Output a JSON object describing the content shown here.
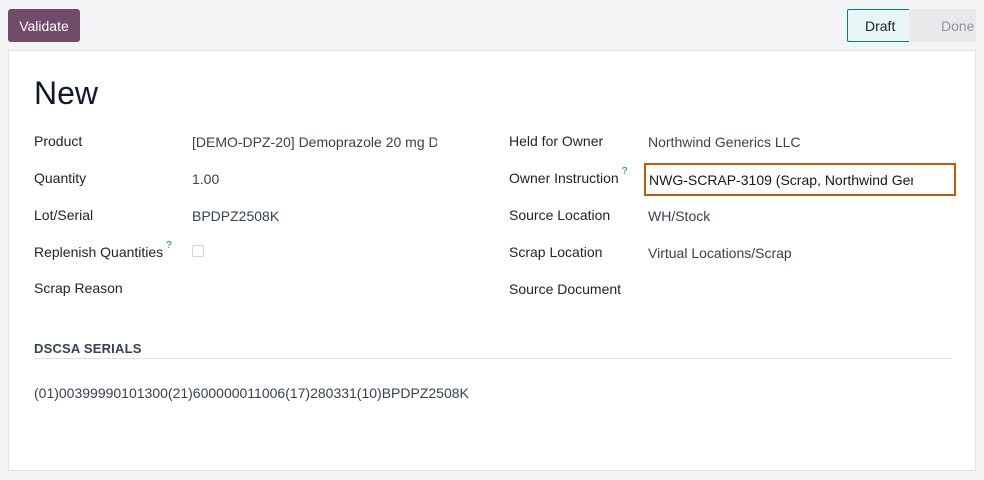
{
  "toolbar": {
    "validate_label": "Validate"
  },
  "statusbar": {
    "stages": [
      "Draft",
      "Done"
    ],
    "active": "Draft"
  },
  "record": {
    "title": "New"
  },
  "left_fields": {
    "product": {
      "label": "Product",
      "value": "[DEMO-DPZ-20] Demoprazole 20 mg D"
    },
    "quantity": {
      "label": "Quantity",
      "value": "1.00"
    },
    "lot_serial": {
      "label": "Lot/Serial",
      "value": "BPDPZ2508K"
    },
    "replenish": {
      "label": "Replenish Quantities",
      "help": "?",
      "checked": false
    },
    "scrap_reason": {
      "label": "Scrap Reason",
      "value": ""
    }
  },
  "right_fields": {
    "owner": {
      "label": "Held for Owner",
      "value": "Northwind Generics LLC"
    },
    "owner_instruction": {
      "label": "Owner Instruction",
      "help": "?",
      "value": "NWG-SCRAP-3109 (Scrap, Northwind Ger"
    },
    "source_location": {
      "label": "Source Location",
      "value": "WH/Stock"
    },
    "scrap_location": {
      "label": "Scrap Location",
      "value": "Virtual Locations/Scrap"
    },
    "source_document": {
      "label": "Source Document",
      "value": ""
    }
  },
  "dscsa": {
    "title": "DSCSA SERIALS",
    "serial": "(01)00399990101300(21)600000011006(17)280331(10)BPDPZ2508K"
  },
  "colors": {
    "primary": "#714b67",
    "status_active": "#017e84",
    "focus_border": "#b85e13"
  }
}
